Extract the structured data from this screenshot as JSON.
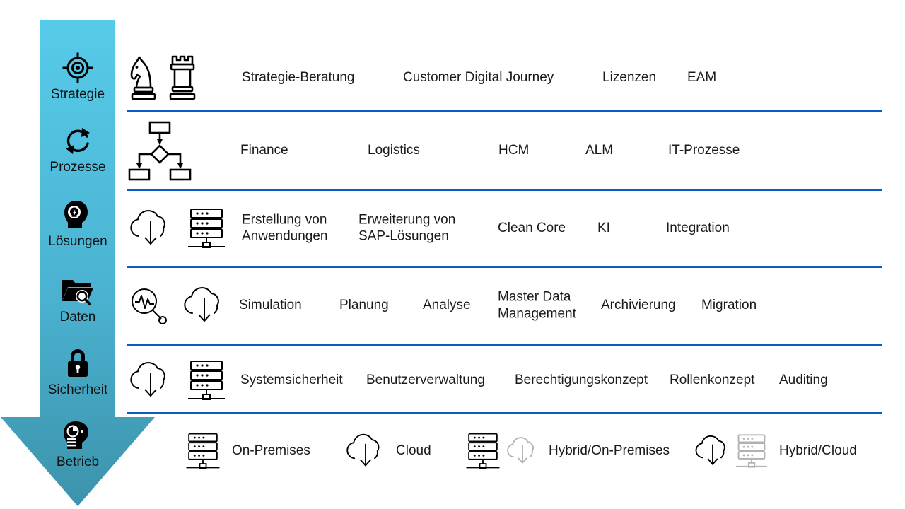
{
  "theme": {
    "arrow_gradient_top": "#54C8E8",
    "arrow_gradient_bottom": "#3E96AD",
    "divider_color": "#0B5BC4",
    "text_color": "#1a1a1a",
    "background": "#ffffff"
  },
  "arrow": {
    "name": "capability-arrow",
    "stages": [
      {
        "label": "Strategie",
        "icon": "target-icon"
      },
      {
        "label": "Prozesse",
        "icon": "refresh-cycle-icon"
      },
      {
        "label": "Lösungen",
        "icon": "head-lightbulb-icon"
      },
      {
        "label": "Daten",
        "icon": "folder-search-icon"
      },
      {
        "label": "Sicherheit",
        "icon": "lock-icon"
      },
      {
        "label": "Betrieb",
        "icon": "head-gear-icon"
      }
    ]
  },
  "rows": [
    {
      "stage": "Strategie",
      "icons": [
        "chess-knight-icon",
        "chess-rook-icon"
      ],
      "items": [
        "Strategie-Beratung",
        "Customer Digital Journey",
        "Lizenzen",
        "EAM"
      ]
    },
    {
      "stage": "Prozesse",
      "icons": [
        "flowchart-icon"
      ],
      "items": [
        "Finance",
        "Logistics",
        "HCM",
        "ALM",
        "IT-Prozesse"
      ]
    },
    {
      "stage": "Lösungen",
      "icons": [
        "cloud-download-icon",
        "server-rack-icon"
      ],
      "items": [
        "Erstellung von\nAnwendungen",
        "Erweiterung von\nSAP-Lösungen",
        "Clean Core",
        "KI",
        "Integration"
      ]
    },
    {
      "stage": "Daten",
      "icons": [
        "analytics-search-icon",
        "cloud-download-icon"
      ],
      "items": [
        "Simulation",
        "Planung",
        "Analyse",
        "Master Data\nManagement",
        "Archivierung",
        "Migration"
      ]
    },
    {
      "stage": "Sicherheit",
      "icons": [
        "cloud-download-icon",
        "server-rack-icon"
      ],
      "items": [
        "Systemsicherheit",
        "Benutzerverwaltung",
        "Berechtigungskonzept",
        "Rollenkonzept",
        "Auditing"
      ]
    }
  ],
  "operations_row": {
    "stage": "Betrieb",
    "items": [
      {
        "label": "On-Premises",
        "icons": [
          "server-rack-icon"
        ]
      },
      {
        "label": "Cloud",
        "icons": [
          "cloud-download-icon"
        ]
      },
      {
        "label": "Hybrid/On-Premises",
        "icons": [
          "server-rack-icon",
          "cloud-download-icon-faded"
        ]
      },
      {
        "label": "Hybrid/Cloud",
        "icons": [
          "cloud-download-icon",
          "server-rack-icon-faded"
        ]
      }
    ]
  }
}
